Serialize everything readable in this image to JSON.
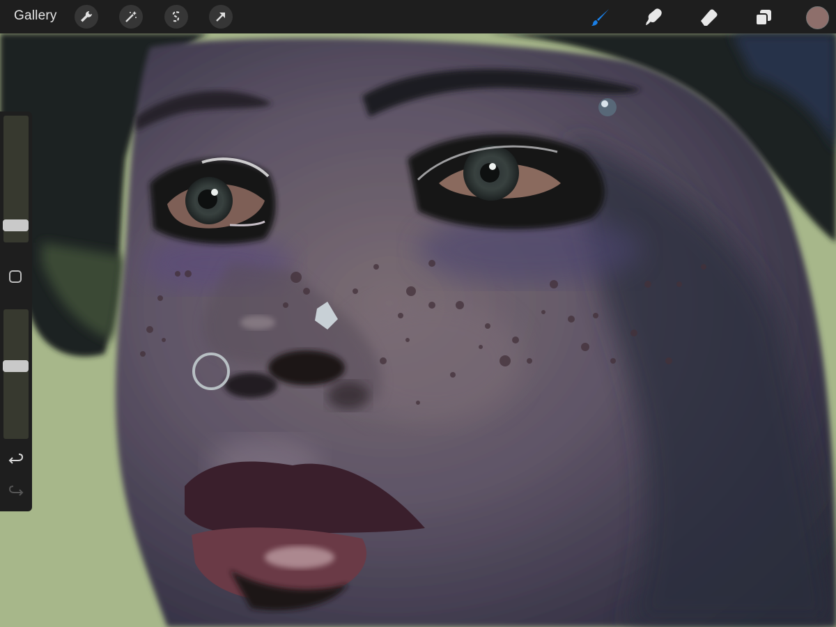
{
  "toolbar": {
    "gallery_label": "Gallery",
    "left_tools": [
      "actions-wrench-icon",
      "adjustments-magic-wand-icon",
      "selection-icon",
      "transform-arrow-icon"
    ],
    "right_tools": [
      "brush-icon",
      "smudge-icon",
      "eraser-icon",
      "layers-icon"
    ],
    "active_tool": "brush",
    "active_color": "#8e6f6b"
  },
  "sidebar": {
    "brush_size_level": 0.1,
    "opacity_level": 0.57,
    "controls": [
      "modify-square",
      "undo",
      "redo"
    ]
  },
  "colors": {
    "accent": "#1a7fe6",
    "canvas_background": "#a7b78a"
  }
}
